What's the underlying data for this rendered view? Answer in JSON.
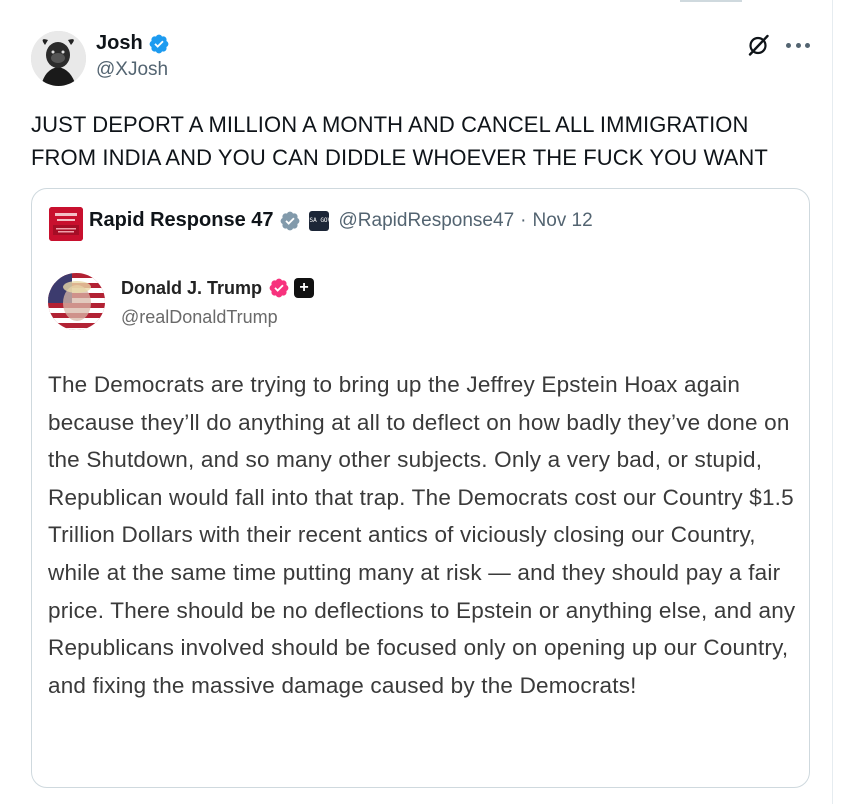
{
  "post": {
    "author_name": "Josh",
    "author_handle": "@XJosh",
    "text": "JUST DEPORT A MILLION A MONTH AND CANCEL ALL IMMIGRATION FROM INDIA AND YOU CAN DIDDLE WHOEVER THE FUCK YOU WANT",
    "icons": {
      "grok": "grok-icon",
      "more": "more-options-icon",
      "verified": "verified-badge-icon"
    }
  },
  "quote": {
    "author_name": "Rapid Response 47",
    "badge_text": "USA GOV",
    "author_handle": "@RapidResponse47",
    "separator": "·",
    "date": "Nov 12",
    "truth_social": {
      "author_name": "Donald J. Trump",
      "author_handle": "@realDonaldTrump",
      "plus_badge": "+",
      "text": "The Democrats are trying to bring up the Jeffrey Epstein Hoax again because they’ll do anything at all to deflect on how badly they’ve done on the Shutdown, and so many other subjects. Only a very bad, or stupid, Republican would fall into that trap. The Democrats cost our Country $1.5 Trillion Dollars with their recent antics of viciously closing our Country, while at the same time putting many at risk — and they should pay a fair price. There should be no deflections to Epstein or anything else, and any Republicans involved should be focused only on opening up our Country, and fixing the massive damage caused by the Democrats!"
    }
  },
  "colors": {
    "verified_blue": "#1d9bf0",
    "verified_gray": "#829aab",
    "secondary_text": "#536471",
    "border": "#cfd9de",
    "truth_badge_pink": "#f7327d"
  }
}
